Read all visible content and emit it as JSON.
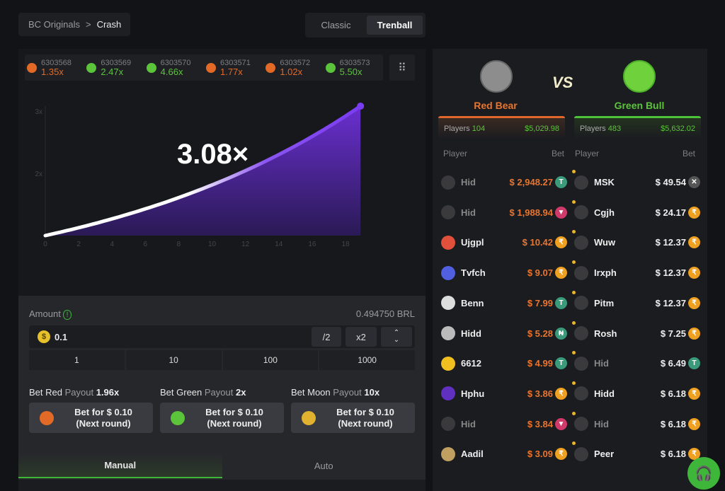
{
  "breadcrumb": {
    "parent": "BC Originals",
    "sep": ">",
    "current": "Crash"
  },
  "modes": [
    "Classic",
    "Trenball"
  ],
  "history": [
    {
      "id": "6303568",
      "value": "1.35x",
      "color": "#e36a26"
    },
    {
      "id": "6303569",
      "value": "2.47x",
      "color": "#5cc43b"
    },
    {
      "id": "6303570",
      "value": "4.66x",
      "color": "#5cc43b"
    },
    {
      "id": "6303571",
      "value": "1.77x",
      "color": "#e36a26"
    },
    {
      "id": "6303572",
      "value": "1.02x",
      "color": "#e36a26"
    },
    {
      "id": "6303573",
      "value": "5.50x",
      "color": "#5cc43b"
    }
  ],
  "chart_data": {
    "type": "line",
    "current_multiplier": "3.08×",
    "current_value": 3.08,
    "current_time": 18.9,
    "x_ticks": [
      "0",
      "2",
      "4",
      "6",
      "8",
      "10",
      "12",
      "14",
      "16",
      "18"
    ],
    "y_ticks": [
      "2x",
      "3x"
    ],
    "xlim": [
      0,
      18
    ],
    "ylim": [
      1,
      3
    ]
  },
  "controls": {
    "amount_label": "Amount",
    "balance": "0.494750 BRL",
    "amount": "0.1",
    "half": "/2",
    "double": "x2",
    "quick": [
      "1",
      "10",
      "100",
      "1000"
    ],
    "bets": [
      {
        "name": "Bet Red",
        "payout_label": "Payout",
        "payout": "1.96x",
        "line1": "Bet for $ 0.10",
        "line2": "(Next round)",
        "color": "#e36a26"
      },
      {
        "name": "Bet Green",
        "payout_label": "Payout",
        "payout": "2x",
        "line1": "Bet for $ 0.10",
        "line2": "(Next round)",
        "color": "#5cc43b"
      },
      {
        "name": "Bet Moon",
        "payout_label": "Payout",
        "payout": "10x",
        "line1": "Bet for $ 0.10",
        "line2": "(Next round)",
        "color": "#e0b230"
      }
    ],
    "tabs": [
      "Manual",
      "Auto"
    ]
  },
  "teams": {
    "vs": "VS",
    "red": {
      "name": "Red Bear",
      "players_label": "Players",
      "players": "104",
      "total": "$5,029.98",
      "col_player": "Player",
      "col_bet": "Bet",
      "rows": [
        [
          "Hid",
          "$ 2,948.27",
          "T"
        ],
        [
          "Hid",
          "$ 1,988.94",
          "TRX"
        ],
        [
          "Ujgpl",
          "$ 10.42",
          "₹"
        ],
        [
          "Tvfch",
          "$ 9.07",
          "₹"
        ],
        [
          "Benn",
          "$ 7.99",
          "T"
        ],
        [
          "Hidd",
          "$ 5.28",
          "₦"
        ],
        [
          "6612",
          "$ 4.99",
          "T"
        ],
        [
          "Hphu",
          "$ 3.86",
          "₹"
        ],
        [
          "Hid",
          "$ 3.84",
          "TRX"
        ],
        [
          "Aadil",
          "$ 3.09",
          "₹"
        ]
      ]
    },
    "green": {
      "name": "Green Bull",
      "players_label": "Players",
      "players": "483",
      "total": "$5,632.02",
      "col_player": "Player",
      "col_bet": "Bet",
      "rows": [
        [
          "MSK",
          "$ 49.54",
          "X"
        ],
        [
          "Cgjh",
          "$ 24.17",
          "₹"
        ],
        [
          "Wuw",
          "$ 12.37",
          "₹"
        ],
        [
          "Irxph",
          "$ 12.37",
          "₹"
        ],
        [
          "Pitm",
          "$ 12.37",
          "₹"
        ],
        [
          "Rosh",
          "$ 7.25",
          "₹"
        ],
        [
          "Hid",
          "$ 6.49",
          "T"
        ],
        [
          "Hidd",
          "$ 6.18",
          "₹"
        ],
        [
          "Hid",
          "$ 6.18",
          "₹"
        ],
        [
          "Peer",
          "$ 6.18",
          "₹"
        ]
      ]
    }
  }
}
